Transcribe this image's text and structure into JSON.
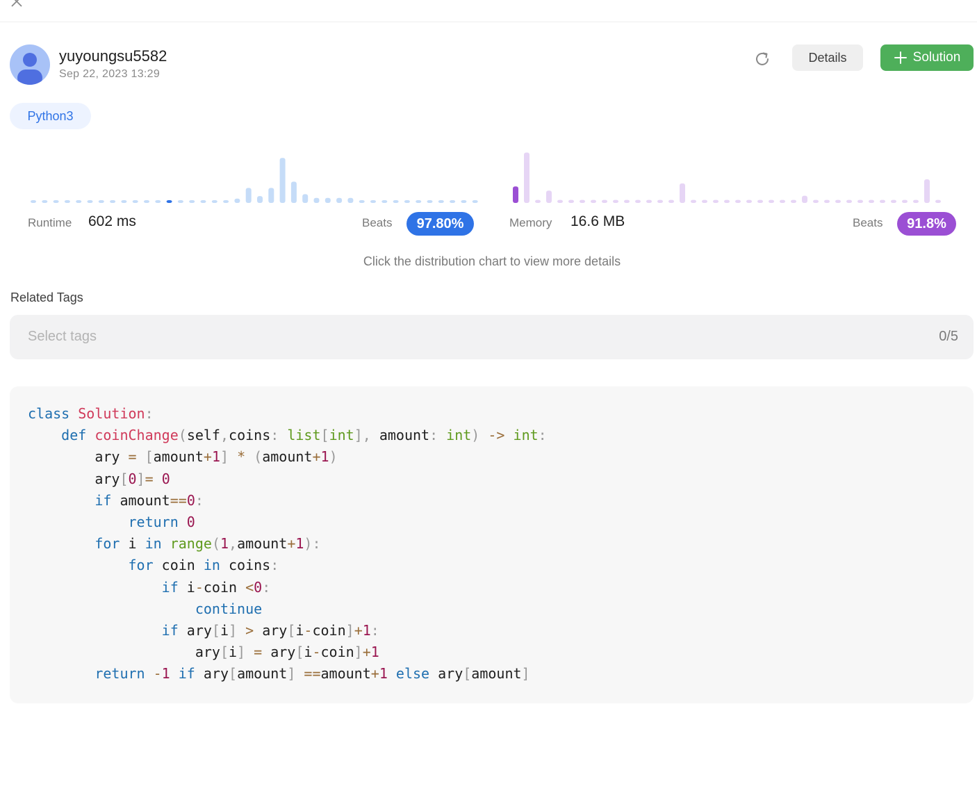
{
  "submission": {
    "username": "yuyoungsu5582",
    "datetime": "Sep 22, 2023 13:29",
    "language": "Python3"
  },
  "actions": {
    "details_label": "Details",
    "solution_label": "Solution"
  },
  "runtime": {
    "label": "Runtime",
    "value": "602 ms",
    "beats_label": "Beats",
    "beats_percent": "97.80%"
  },
  "memory": {
    "label": "Memory",
    "value": "16.6 MB",
    "beats_label": "Beats",
    "beats_percent": "91.8%"
  },
  "hint": "Click the distribution chart to view more details",
  "tags": {
    "title": "Related Tags",
    "placeholder": "Select tags",
    "count": "0/5"
  },
  "colors": {
    "runtime_bar": "#c5dcf8",
    "runtime_highlight": "#2f73e6",
    "memory_bar": "#e6d5f5",
    "memory_highlight": "#9b4fd4",
    "solution_green": "#4eaf5a"
  },
  "chart_data": [
    {
      "type": "bar",
      "values": [
        0.2,
        0.2,
        0.2,
        0.2,
        0.2,
        0.2,
        0.2,
        0.2,
        0.2,
        0.2,
        0.2,
        0.2,
        0.2,
        0.2,
        0.2,
        0.2,
        0.2,
        0.2,
        0.35,
        1.2,
        0.55,
        1.2,
        3.6,
        1.7,
        0.7,
        0.4,
        0.4,
        0.4,
        0.4,
        0.2,
        0.2,
        0.2,
        0.2,
        0.2,
        0.2,
        0.2,
        0.2,
        0.2,
        0.2,
        0.2
      ],
      "highlight_index": 12,
      "ylim": [
        0,
        4
      ]
    },
    {
      "type": "bar",
      "values": [
        1.6,
        4.9,
        0.3,
        1.2,
        0.3,
        0.3,
        0.3,
        0.3,
        0.3,
        0.3,
        0.3,
        0.3,
        0.3,
        0.3,
        0.3,
        1.9,
        0.3,
        0.3,
        0.3,
        0.3,
        0.3,
        0.3,
        0.3,
        0.3,
        0.3,
        0.3,
        0.7,
        0.3,
        0.3,
        0.3,
        0.3,
        0.3,
        0.3,
        0.3,
        0.3,
        0.3,
        0.3,
        2.3,
        0.3
      ],
      "highlight_index": 0,
      "ylim": [
        0,
        5
      ]
    }
  ]
}
